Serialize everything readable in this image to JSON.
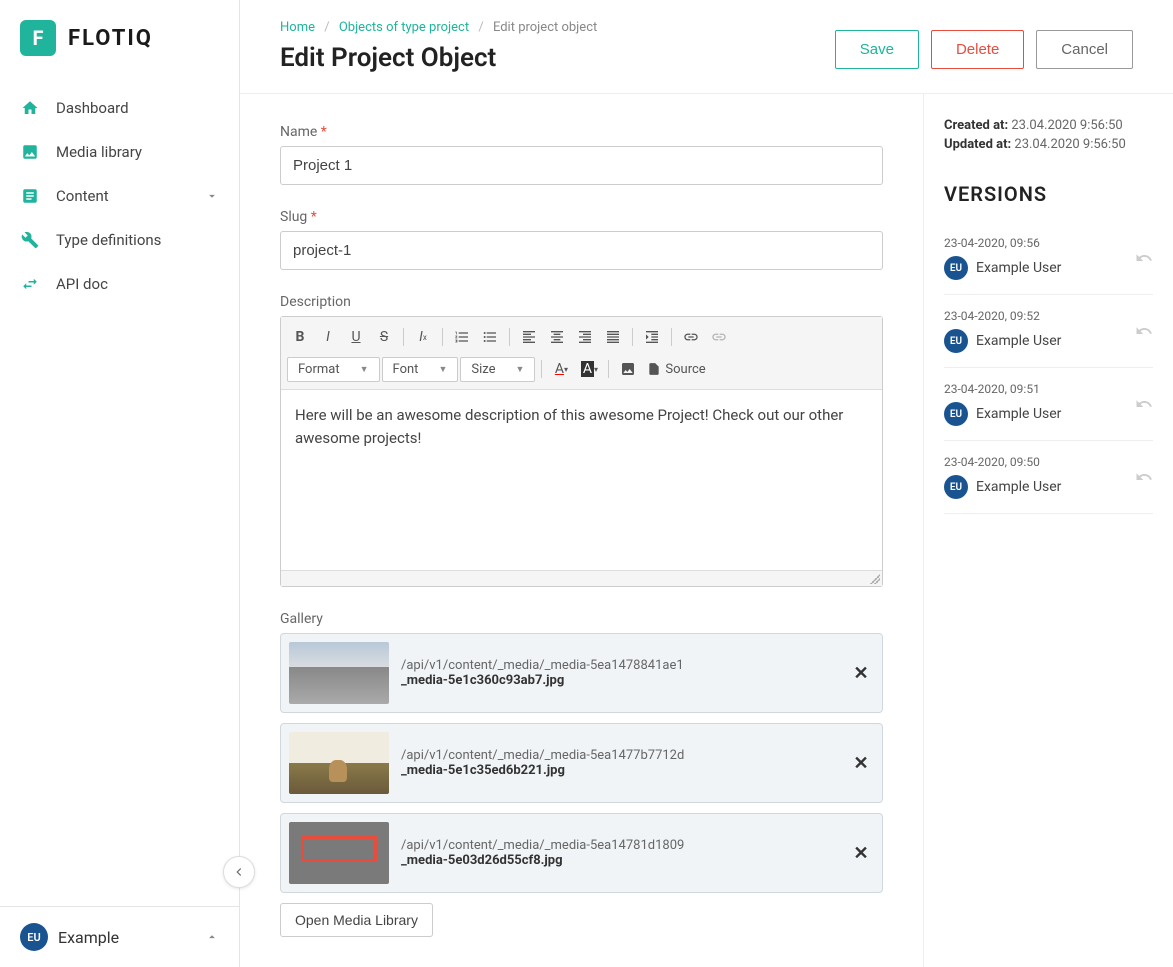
{
  "brand": {
    "name": "FLOTIQ",
    "mark": "F"
  },
  "nav": {
    "dashboard": "Dashboard",
    "media": "Media library",
    "content": "Content",
    "types": "Type definitions",
    "api": "API doc"
  },
  "user": {
    "initials": "EU",
    "name": "Example"
  },
  "breadcrumb": {
    "home": "Home",
    "objects": "Objects of type project",
    "current": "Edit project object"
  },
  "page_title": "Edit Project Object",
  "actions": {
    "save": "Save",
    "delete": "Delete",
    "cancel": "Cancel"
  },
  "form": {
    "name_label": "Name",
    "name_value": "Project 1",
    "slug_label": "Slug",
    "slug_value": "project-1",
    "description_label": "Description",
    "description_value": "Here will be an awesome description of this awesome Project! Check out our other awesome projects!",
    "gallery_label": "Gallery",
    "open_media": "Open Media Library"
  },
  "editor": {
    "format": "Format",
    "font": "Font",
    "size": "Size",
    "source": "Source"
  },
  "gallery": [
    {
      "path": "/api/v1/content/_media/_media-5ea1478841ae1",
      "filename": "_media-5e1c360c93ab7.jpg",
      "thumb": "city"
    },
    {
      "path": "/api/v1/content/_media/_media-5ea1477b7712d",
      "filename": "_media-5e1c35ed6b221.jpg",
      "thumb": "dog"
    },
    {
      "path": "/api/v1/content/_media/_media-5ea14781d1809",
      "filename": "_media-5e03d26d55cf8.jpg",
      "thumb": "welcome"
    }
  ],
  "meta": {
    "created_label": "Created at:",
    "created_value": "23.04.2020 9:56:50",
    "updated_label": "Updated at:",
    "updated_value": "23.04.2020 9:56:50"
  },
  "versions_title": "VERSIONS",
  "versions": [
    {
      "date": "23-04-2020, 09:56",
      "user": "Example User",
      "initials": "EU"
    },
    {
      "date": "23-04-2020, 09:52",
      "user": "Example User",
      "initials": "EU"
    },
    {
      "date": "23-04-2020, 09:51",
      "user": "Example User",
      "initials": "EU"
    },
    {
      "date": "23-04-2020, 09:50",
      "user": "Example User",
      "initials": "EU"
    }
  ]
}
